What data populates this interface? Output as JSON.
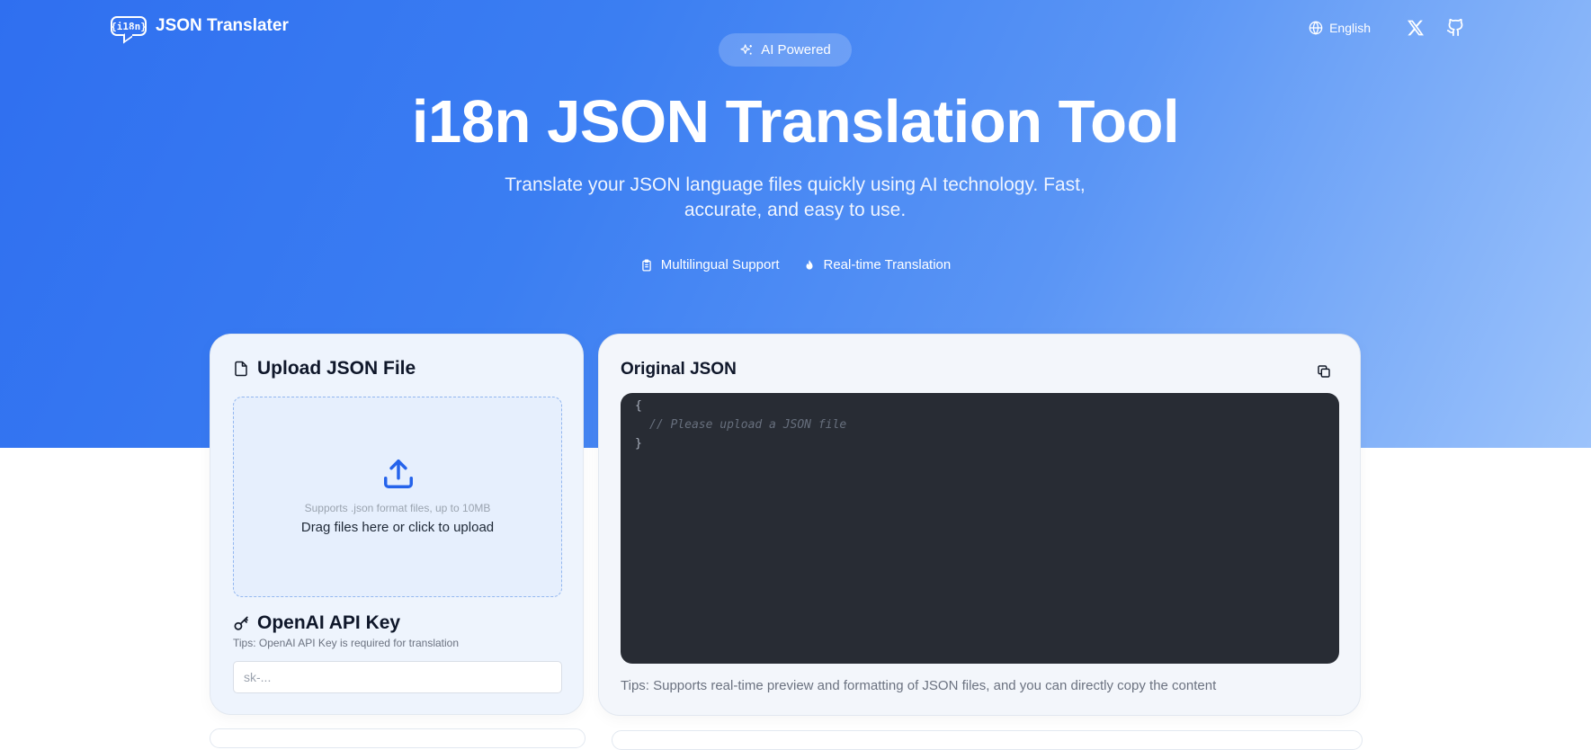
{
  "nav": {
    "logo_badge": "{i18n}",
    "logo_text": "JSON Translater",
    "language": "English",
    "icons": [
      "globe-icon",
      "x-icon",
      "github-icon"
    ]
  },
  "hero": {
    "badge": "AI Powered",
    "title": "i18n JSON Translation Tool",
    "subtitle": "Translate your JSON language files quickly using AI technology. Fast, accurate, and easy to use.",
    "features": [
      {
        "label": "Multilingual Support",
        "icon": "clipboard-icon"
      },
      {
        "label": "Real-time Translation",
        "icon": "flame-icon"
      }
    ]
  },
  "upload": {
    "title": "Upload JSON File",
    "hint": "Supports .json format files, up to 10MB",
    "main": "Drag files here or click to upload"
  },
  "api": {
    "title": "OpenAI API Key",
    "tip": "Tips: OpenAI API Key is required for translation",
    "placeholder": "sk-..."
  },
  "original": {
    "title": "Original JSON",
    "code_lines": [
      "{",
      "// Please upload a JSON file",
      "}"
    ],
    "tip": "Tips: Supports real-time preview and formatting of JSON files, and you can directly copy the content"
  },
  "colors": {
    "hero_start": "#2f6ff0",
    "hero_end": "#9cc3fb",
    "accent": "#2563eb",
    "code_bg": "#282c34"
  }
}
